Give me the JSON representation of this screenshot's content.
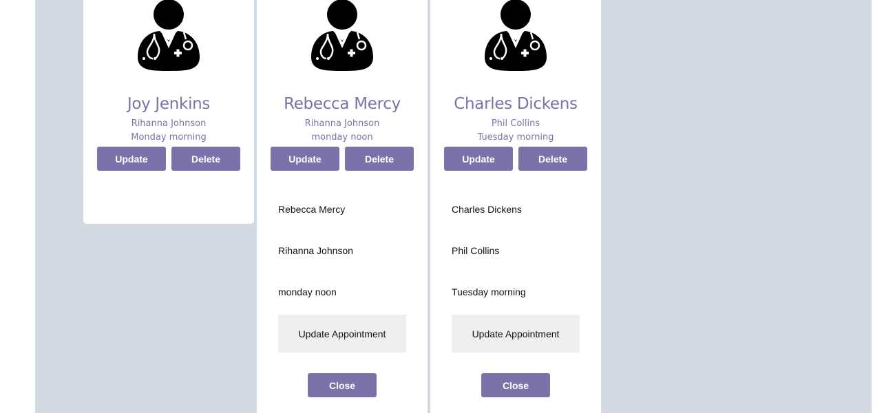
{
  "colors": {
    "accent": "#7b72a9",
    "panel_background": "#d3dae2",
    "card_background": "#ffffff",
    "secondary_button": "#efefef"
  },
  "cards": [
    {
      "icon": "doctor-icon",
      "name": "Joy Jenkins",
      "patient": "Rihanna Johnson",
      "time": "Monday morning",
      "update_label": "Update",
      "delete_label": "Delete"
    },
    {
      "icon": "doctor-icon",
      "name": "Rebecca Mercy",
      "patient": "Rihanna Johnson",
      "time": "monday noon",
      "update_label": "Update",
      "delete_label": "Delete",
      "form": {
        "doctor_value": "Rebecca Mercy",
        "patient_value": "Rihanna Johnson",
        "time_value": "monday noon",
        "submit_label": "Update Appointment",
        "close_label": "Close"
      }
    },
    {
      "icon": "doctor-icon",
      "name": "Charles Dickens",
      "patient": "Phil Collins",
      "time": "Tuesday morning",
      "update_label": "Update",
      "delete_label": "Delete",
      "form": {
        "doctor_value": "Charles Dickens",
        "patient_value": "Phil Collins",
        "time_value": "Tuesday morning",
        "submit_label": "Update Appointment",
        "close_label": "Close"
      }
    }
  ]
}
